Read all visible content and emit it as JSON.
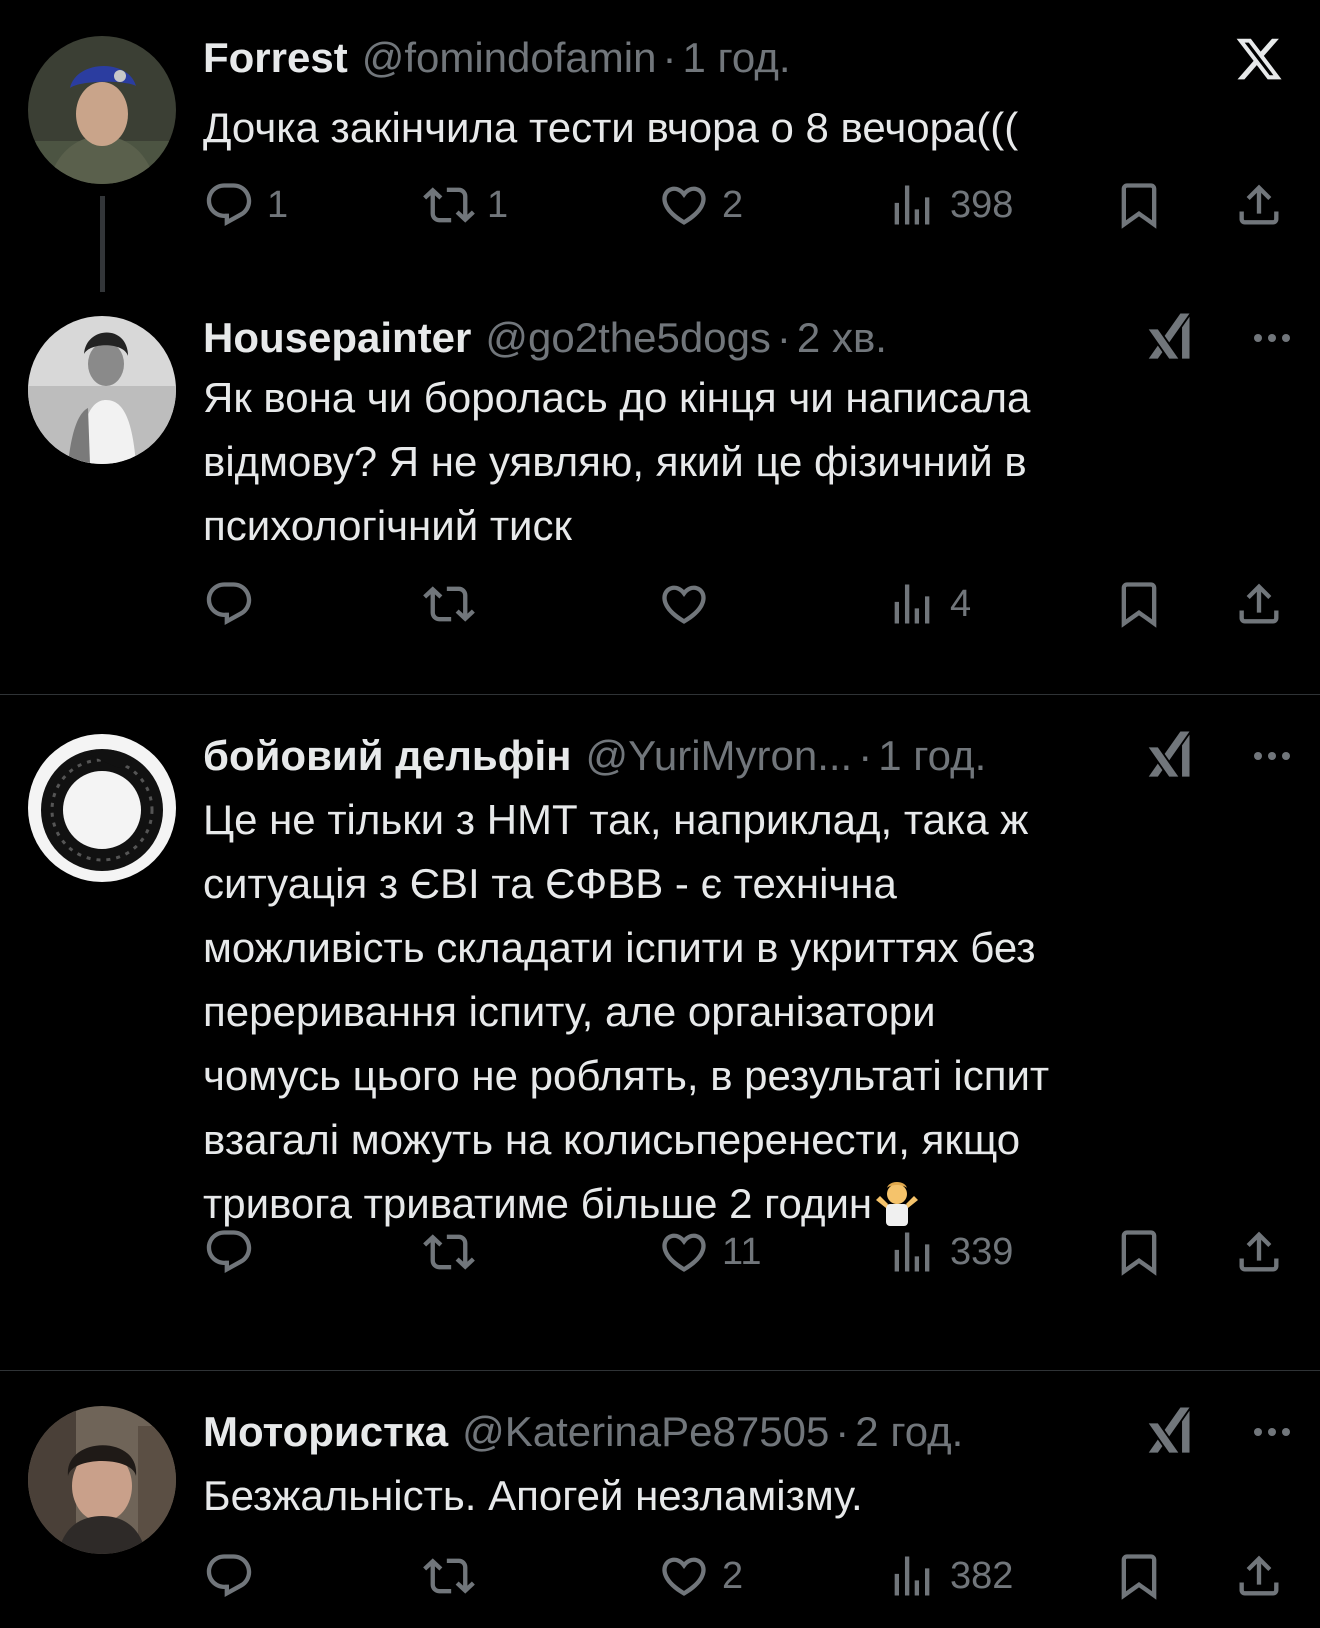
{
  "posts": [
    {
      "name": "Forrest",
      "handle": "@fomindofamin",
      "dot": "·",
      "time": "1 год.",
      "text": [
        "Дочка закінчила тести вчора о 8 вечора((("
      ],
      "replies": "1",
      "reposts": "1",
      "likes": "2",
      "views": "398"
    },
    {
      "name": "Housepainter",
      "handle": "@go2the5dogs",
      "dot": "·",
      "time": "2 хв.",
      "text": [
        "Як вона чи боролась до кінця чи написала",
        "відмову? Я не уявляю, який це фізичний в",
        "психологічний тиск"
      ],
      "replies": "",
      "reposts": "",
      "likes": "",
      "views": "4"
    },
    {
      "name": "бойовий дельфін",
      "handle": "@YuriMyron...",
      "dot": "·",
      "time": "1 год.",
      "text": [
        "Це не тільки з НМТ так, наприклад, така ж",
        "ситуація з ЄВІ та ЄФВВ - є технічна",
        "можливість складати іспити в укриттях без",
        "переривання іспиту, але організатори",
        "чомусь цього не роблять, в результаті іспит",
        "взагалі можуть на колисьперенести, якщо",
        "тривога триватиме більше 2 годин"
      ],
      "replies": "",
      "reposts": "",
      "likes": "11",
      "views": "339"
    },
    {
      "name": "Мотористка",
      "handle": "@KaterinaPe87505",
      "dot": "·",
      "time": "2 год.",
      "text": [
        "Безжальність. Апогей незламізму."
      ],
      "replies": "",
      "reposts": "",
      "likes": "2",
      "views": "382"
    }
  ],
  "icons": {
    "close": "x-logo-icon",
    "reply": "reply-icon",
    "repost": "repost-icon",
    "like": "heart-icon",
    "views": "views-icon",
    "bookmark": "bookmark-icon",
    "share": "share-icon",
    "grok": "grok-icon",
    "more": "more-icon",
    "emoji": "person-shrugging-emoji"
  },
  "colors": {
    "background": "#000000",
    "text": "#e7e9ea",
    "muted": "#71767b",
    "divider": "#2f3336"
  }
}
